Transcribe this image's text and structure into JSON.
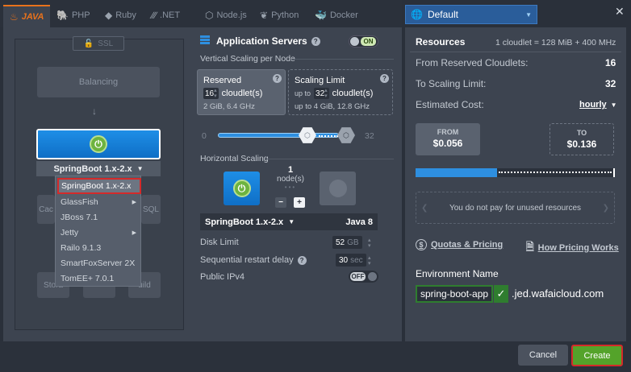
{
  "tabs": [
    {
      "label": "JAVA",
      "icon": "java-icon",
      "active": true
    },
    {
      "label": "PHP",
      "icon": "php-icon"
    },
    {
      "label": "Ruby",
      "icon": "ruby-icon"
    },
    {
      "label": ".NET",
      "icon": "dotnet-icon"
    },
    {
      "label": "Node.js",
      "icon": "nodejs-icon"
    },
    {
      "label": "Python",
      "icon": "python-icon"
    },
    {
      "label": "Docker",
      "icon": "docker-icon"
    }
  ],
  "topology": {
    "ssl_label": "SSL",
    "balancing_label": "Balancing",
    "server_label": "SpringBoot 1.x-2.x",
    "ghost_left": "Cac",
    "ghost_right": "SQL",
    "ghost_bottom_left": "Stora",
    "ghost_bottom_right": "uild",
    "dropdown": [
      {
        "label": "SpringBoot 1.x-2.x",
        "selected": true,
        "submenu": false
      },
      {
        "label": "GlassFish",
        "submenu": true
      },
      {
        "label": "JBoss 7.1",
        "submenu": false
      },
      {
        "label": "Jetty",
        "submenu": true
      },
      {
        "label": "Railo 9.1.3",
        "submenu": false
      },
      {
        "label": "SmartFoxServer 2X",
        "submenu": false
      },
      {
        "label": "TomEE+ 7.0.1",
        "submenu": false
      }
    ]
  },
  "app_servers": {
    "title": "Application Servers",
    "toggle": "ON",
    "vertical_label": "Vertical Scaling per Node",
    "reserved": {
      "title": "Reserved",
      "value": "16",
      "unit": "cloudlet(s)",
      "sub": "2 GiB, 6.4 GHz"
    },
    "limit": {
      "title": "Scaling Limit",
      "prefix": "up to",
      "value": "32",
      "unit": "cloudlet(s)",
      "sub_prefix": "up to",
      "sub": "4 GiB, 12.8 GHz"
    },
    "slider_min": "0",
    "slider_max": "32",
    "horizontal_label": "Horizontal Scaling",
    "nodes_count": "1",
    "nodes_unit": "node(s)",
    "minus": "−",
    "plus": "+",
    "selected_stack": "SpringBoot 1.x-2.x",
    "java_version": "Java 8",
    "disk_limit_label": "Disk Limit",
    "disk_limit_value": "52",
    "disk_limit_unit": "GB",
    "restart_label": "Sequential restart delay",
    "restart_value": "30",
    "restart_unit": "sec",
    "ipv4_label": "Public IPv4",
    "ipv4_toggle": "OFF"
  },
  "right": {
    "env_region": "Default",
    "resources_label": "Resources",
    "resources_note": "1 cloudlet = 128 MiB + 400 MHz",
    "from_prefix": "From",
    "from_label": "Reserved Cloudlets:",
    "from_value": "16",
    "to_prefix": "To",
    "to_label": "Scaling Limit:",
    "to_value": "32",
    "cost_label": "Estimated Cost:",
    "cost_period": "hourly",
    "cost_from_caption": "FROM",
    "cost_from_value": "$0.056",
    "cost_to_caption": "TO",
    "cost_to_value": "$0.136",
    "cost_fill_fraction": 0.41,
    "unused_note": "You do not pay for unused resources",
    "quotas_link": "Quotas & Pricing",
    "pricing_link": "How Pricing Works",
    "env_name_label": "Environment Name",
    "env_name_value": "spring-boot-app",
    "env_domain": ".jed.wafaicloud.com"
  },
  "footer": {
    "cancel": "Cancel",
    "create": "Create"
  },
  "colors": {
    "accent_blue": "#2e8fe0",
    "brand_orange": "#e8721c",
    "create_green": "#54a32a",
    "highlight_red": "#d42a2a"
  }
}
